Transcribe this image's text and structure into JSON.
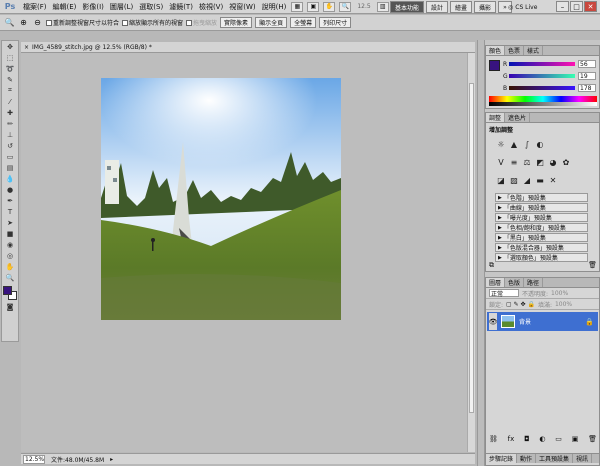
{
  "app": {
    "logo": "Ps",
    "menus": [
      "檔案(F)",
      "編輯(E)",
      "影像(I)",
      "圖層(L)",
      "選取(S)",
      "濾鏡(T)",
      "檢視(V)",
      "視窗(W)",
      "說明(H)"
    ],
    "zoom_display": "12.5",
    "workspaces": [
      "基本功能",
      "設計",
      "繪畫",
      "攝影"
    ],
    "workspace_more": "»",
    "cs_live": "CS Live"
  },
  "options": {
    "resize_windows": "重新調整視窗尺寸以符合",
    "zoom_all": "縮放顯示所有的視窗",
    "scrubby_zoom": "拖曳縮放",
    "buttons": [
      "實際像素",
      "顯示全頁",
      "全螢幕",
      "列印尺寸"
    ]
  },
  "document": {
    "tab_title": "IMG_4589_stitch.jpg @ 12.5% (RGB/8) *",
    "zoom_field": "12.5%",
    "status": "文件:48.0M/45.8M"
  },
  "colors": {
    "foreground": "#38137e",
    "accent_layer": "#3e6fd1"
  },
  "color_panel": {
    "tabs": [
      "顏色",
      "色票",
      "樣式"
    ],
    "channels": [
      {
        "label": "R",
        "value": "56"
      },
      {
        "label": "G",
        "value": "19"
      },
      {
        "label": "B",
        "value": "178"
      }
    ]
  },
  "adjust_panel": {
    "tabs": [
      "調整",
      "遮色片"
    ],
    "title": "增加調整",
    "presets": [
      "「色階」預設集",
      "「曲線」預設集",
      "「曝光度」預設集",
      "「色相/飽和度」預設集",
      "「黑白」預設集",
      "「色版混合器」預設集",
      "「選取顏色」預設集"
    ]
  },
  "layers_panel": {
    "tabs": [
      "圖層",
      "色版",
      "路徑"
    ],
    "blend_mode": "正常",
    "opacity_label": "不透明度:",
    "opacity": "100%",
    "lock_label": "鎖定:",
    "fill_label": "填滿:",
    "fill": "100%",
    "layer_name": "背景",
    "bottom_tabs": [
      "步驟記錄",
      "動作",
      "工具預設集",
      "視訊"
    ]
  }
}
